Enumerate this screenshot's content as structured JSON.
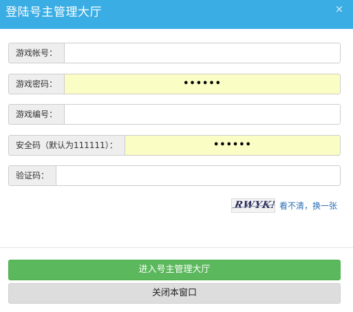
{
  "dialog": {
    "title": "登陆号主管理大厅",
    "close_glyph": "×"
  },
  "fields": [
    {
      "label": "游戏帐号：",
      "value": ""
    },
    {
      "label": "游戏密码：",
      "value": "••••••"
    },
    {
      "label": "游戏编号：",
      "value": ""
    },
    {
      "label": "安全码（默认为111111）：",
      "value": "••••••"
    },
    {
      "label": "验证码：",
      "value": ""
    }
  ],
  "captcha": {
    "image_text": "RWYKM",
    "refresh_label": "看不清，换一张"
  },
  "buttons": {
    "enter_label": "进入号主管理大厅",
    "close_window_label": "关闭本窗口"
  },
  "colors": {
    "titlebar": "#39ade4",
    "autofill": "#fafdc4",
    "primary": "#5cb85c",
    "link": "#2a6eb5"
  },
  "icons": {
    "close": "close-icon"
  }
}
